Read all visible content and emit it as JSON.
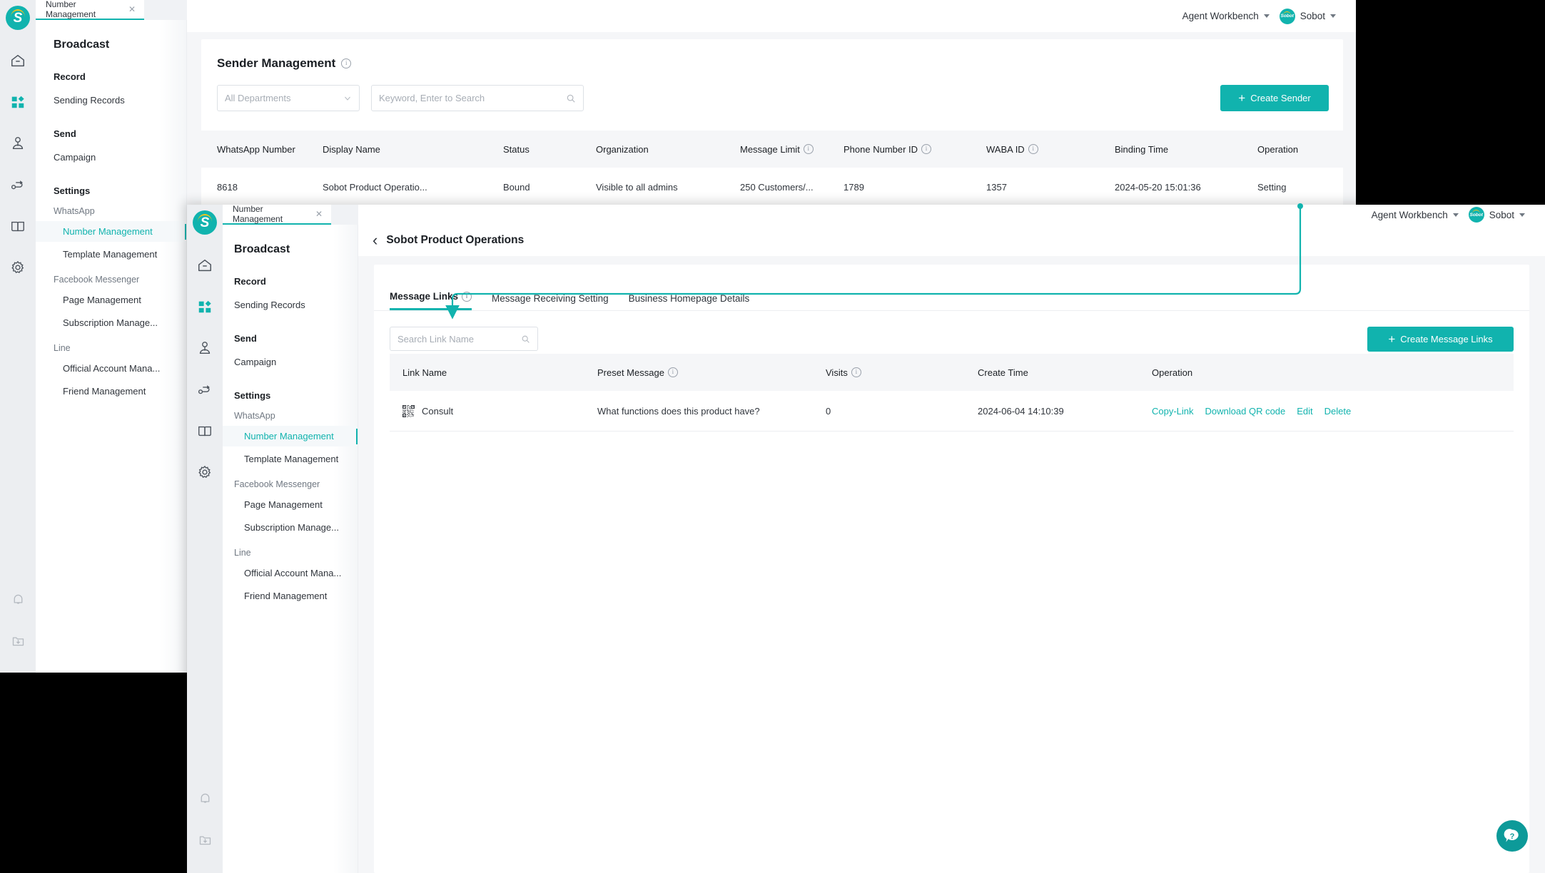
{
  "colors": {
    "accent": "#11b3ae",
    "link": "#11b3ae",
    "header_bg": "#f5f6f8",
    "rail_bg": "#eceef1"
  },
  "background_window": {
    "tab": {
      "label": "Number Management",
      "close": "✕"
    },
    "header": {
      "workbench": "Agent Workbench",
      "user": "Sobot",
      "avatar_text": "Sobot"
    },
    "rail_icons": [
      "home-icon",
      "apps-icon",
      "contacts-icon",
      "workflow-icon",
      "knowledge-icon",
      "settings-icon",
      "bell-icon",
      "archive-icon"
    ],
    "menu": {
      "title": "Broadcast",
      "sections": [
        {
          "group": "Record",
          "items": [
            {
              "label": "Sending Records",
              "active": false
            }
          ]
        },
        {
          "group": "Send",
          "items": [
            {
              "label": "Campaign",
              "active": false
            }
          ]
        },
        {
          "group": "Settings",
          "items": []
        }
      ],
      "settings_groups": [
        {
          "sub": "WhatsApp",
          "items": [
            {
              "label": "Number Management",
              "active": true
            },
            {
              "label": "Template Management",
              "active": false
            }
          ]
        },
        {
          "sub": "Facebook Messenger",
          "items": [
            {
              "label": "Page Management",
              "active": false
            },
            {
              "label": "Subscription Manage...",
              "active": false
            }
          ]
        },
        {
          "sub": "Line",
          "items": [
            {
              "label": "Official Account Mana...",
              "active": false
            },
            {
              "label": "Friend Management",
              "active": false
            }
          ]
        }
      ]
    },
    "page_title": "Sender Management",
    "filters": {
      "department_value": "All Departments",
      "search_placeholder": "Keyword, Enter to Search"
    },
    "create_button": "Create Sender",
    "table": {
      "columns": [
        {
          "label": "WhatsApp Number",
          "info": false
        },
        {
          "label": "Display Name",
          "info": false
        },
        {
          "label": "Status",
          "info": false
        },
        {
          "label": "Organization",
          "info": false
        },
        {
          "label": "Message Limit",
          "info": true
        },
        {
          "label": "Phone Number ID",
          "info": true
        },
        {
          "label": "WABA ID",
          "info": true
        },
        {
          "label": "Binding Time",
          "info": false
        },
        {
          "label": "Operation",
          "info": false
        }
      ],
      "rows": [
        {
          "whatsapp_number": "8618",
          "display_name": "Sobot Product Operatio...",
          "status": "Bound",
          "organization": "Visible to all admins",
          "message_limit": "250 Customers/...",
          "phone_number_id": "1789",
          "waba_id": "1357",
          "binding_time": "2024-05-20 15:01:36",
          "operation": "Setting"
        }
      ]
    }
  },
  "foreground_window": {
    "tab": {
      "label": "Number Management",
      "close": "✕"
    },
    "header": {
      "workbench": "Agent Workbench",
      "user": "Sobot",
      "avatar_text": "Sobot"
    },
    "rail_icons": [
      "home-icon",
      "apps-icon",
      "contacts-icon",
      "workflow-icon",
      "knowledge-icon",
      "settings-icon",
      "bell-icon",
      "archive-icon"
    ],
    "menu": {
      "title": "Broadcast",
      "sections": [
        {
          "group": "Record",
          "items": [
            {
              "label": "Sending Records",
              "active": false
            }
          ]
        },
        {
          "group": "Send",
          "items": [
            {
              "label": "Campaign",
              "active": false
            }
          ]
        },
        {
          "group": "Settings",
          "items": []
        }
      ],
      "settings_groups": [
        {
          "sub": "WhatsApp",
          "items": [
            {
              "label": "Number Management",
              "active": true
            },
            {
              "label": "Template Management",
              "active": false
            }
          ]
        },
        {
          "sub": "Facebook Messenger",
          "items": [
            {
              "label": "Page Management",
              "active": false
            },
            {
              "label": "Subscription Manage...",
              "active": false
            }
          ]
        },
        {
          "sub": "Line",
          "items": [
            {
              "label": "Official Account Mana...",
              "active": false
            },
            {
              "label": "Friend Management",
              "active": false
            }
          ]
        }
      ]
    },
    "breadcrumb": {
      "back": "‹",
      "title": "Sobot Product Operations"
    },
    "tabs": [
      {
        "label": "Message Links",
        "info": true,
        "active": true
      },
      {
        "label": "Message Receiving Setting",
        "info": false,
        "active": false
      },
      {
        "label": "Business Homepage Details",
        "info": false,
        "active": false
      }
    ],
    "search_placeholder": "Search Link Name",
    "create_button": "Create Message Links",
    "table": {
      "columns": [
        {
          "label": "Link Name",
          "info": false
        },
        {
          "label": "Preset Message",
          "info": true
        },
        {
          "label": "Visits",
          "info": true
        },
        {
          "label": "Create Time",
          "info": false
        },
        {
          "label": "Operation",
          "info": false
        }
      ],
      "rows": [
        {
          "link_name": "Consult",
          "preset_message": "What functions does this product have?",
          "visits": "0",
          "create_time": "2024-06-04 14:10:39",
          "operations": [
            "Copy-Link",
            "Download QR code",
            "Edit",
            "Delete"
          ]
        }
      ]
    },
    "help_button": "?"
  },
  "annotation": {
    "type": "arrow",
    "from": "Setting link",
    "to": "Message Links tab",
    "color": "#11b3ae"
  }
}
